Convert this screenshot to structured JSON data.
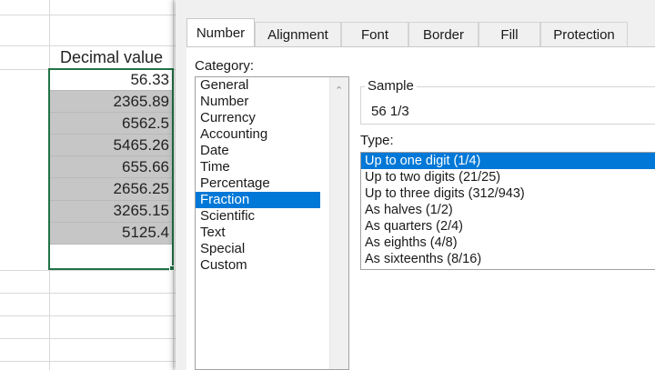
{
  "sheet": {
    "header": "Decimal value",
    "values": [
      "56.33",
      "2365.89",
      "6562.5",
      "5465.26",
      "655.66",
      "2656.25",
      "3265.15",
      "5125.4"
    ]
  },
  "dialog": {
    "tabs": [
      {
        "label": "Number",
        "active": true
      },
      {
        "label": "Alignment",
        "active": false
      },
      {
        "label": "Font",
        "active": false
      },
      {
        "label": "Border",
        "active": false
      },
      {
        "label": "Fill",
        "active": false
      },
      {
        "label": "Protection",
        "active": false
      }
    ],
    "category_label": "Category:",
    "categories": [
      "General",
      "Number",
      "Currency",
      "Accounting",
      "Date",
      "Time",
      "Percentage",
      "Fraction",
      "Scientific",
      "Text",
      "Special",
      "Custom"
    ],
    "selected_category": "Fraction",
    "sample_label": "Sample",
    "sample_value": "56 1/3",
    "type_label": "Type:",
    "types": [
      "Up to one digit (1/4)",
      "Up to two digits (21/25)",
      "Up to three digits (312/943)",
      "As halves (1/2)",
      "As quarters (2/4)",
      "As eighths (4/8)",
      "As sixteenths (8/16)"
    ],
    "selected_type": "Up to one digit (1/4)"
  },
  "colors": {
    "selection_blue": "#0078d7",
    "excel_green": "#217346",
    "selected_cell_gray": "#c6c6c6"
  }
}
